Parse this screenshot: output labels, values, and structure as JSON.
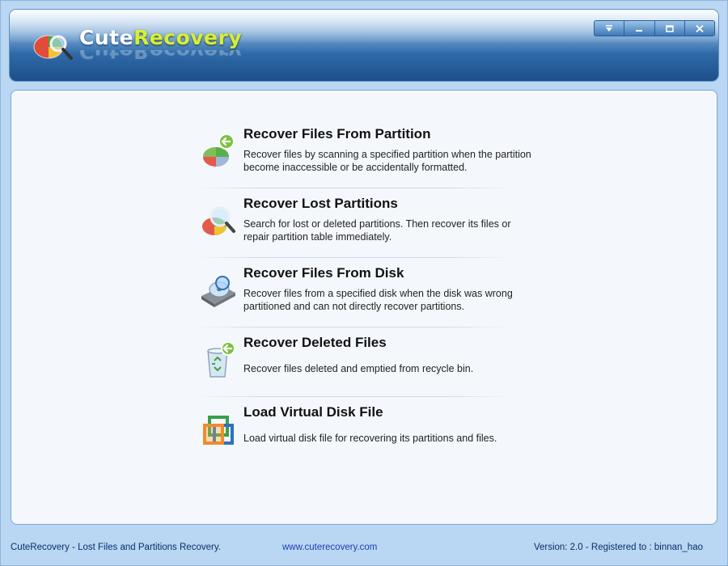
{
  "header": {
    "brand_part1": "Cute",
    "brand_part2": "Recovery",
    "controls": [
      "menu",
      "minimize",
      "maximize",
      "close"
    ]
  },
  "items": [
    {
      "title": "Recover Files From Partition",
      "desc": "Recover files by scanning a specified partition when the partition become inaccessible or be accidentally formatted.",
      "icon": "partition-recover-icon"
    },
    {
      "title": "Recover Lost Partitions",
      "desc": "Search for lost or deleted partitions. Then recover its files or repair partition table immediately.",
      "icon": "partition-search-icon"
    },
    {
      "title": "Recover Files From Disk",
      "desc": "Recover files from a specified disk when the disk was wrong partitioned and can not directly recover partitions.",
      "icon": "disk-recover-icon"
    },
    {
      "title": "Recover Deleted Files",
      "desc": "Recover files deleted and emptied from recycle bin.",
      "icon": "recycle-bin-icon"
    },
    {
      "title": "Load Virtual Disk File",
      "desc": "Load virtual disk file for recovering its partitions and files.",
      "icon": "virtual-disk-icon"
    }
  ],
  "status": {
    "left": "CuteRecovery - Lost Files and Partitions Recovery.",
    "link": "www.cuterecovery.com",
    "right": "Version: 2.0 - Registered to : binnan_hao"
  },
  "colors": {
    "header_top": "#e9f3fc",
    "header_bottom": "#1d4f8a",
    "brand_accent": "#d8ec3a",
    "window_bg": "#b9d7f3",
    "panel_bg": "#f4f8fc"
  }
}
